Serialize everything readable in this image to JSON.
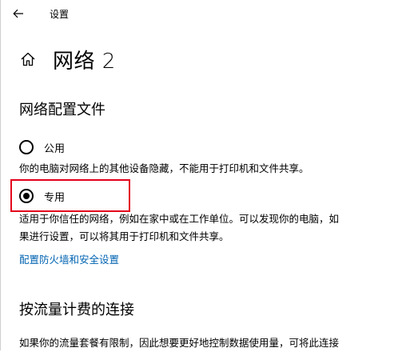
{
  "window": {
    "app_title": "设置"
  },
  "header": {
    "page_title": "网络 2"
  },
  "network_profile": {
    "heading": "网络配置文件",
    "options": [
      {
        "label": "公用",
        "selected": false,
        "description": "你的电脑对网络上的其他设备隐藏，不能用于打印机和文件共享。"
      },
      {
        "label": "专用",
        "selected": true,
        "description_line1": "适用于你信任的网络，例如在家中或在工作单位。可以发现你的电脑，如",
        "description_line2": "果进行设置，可以将其用于打印机和文件共享。"
      }
    ],
    "firewall_link": "配置防火墙和安全设置"
  },
  "metered": {
    "heading": "按流量计费的连接",
    "description": "如果你的流量套餐有限制，因此想要更好地控制数据使用量，可将此连接"
  },
  "colors": {
    "link": "#0063b1",
    "highlight": "#e3001b"
  },
  "icons": {
    "back": "back-arrow-icon",
    "home": "home-icon"
  }
}
